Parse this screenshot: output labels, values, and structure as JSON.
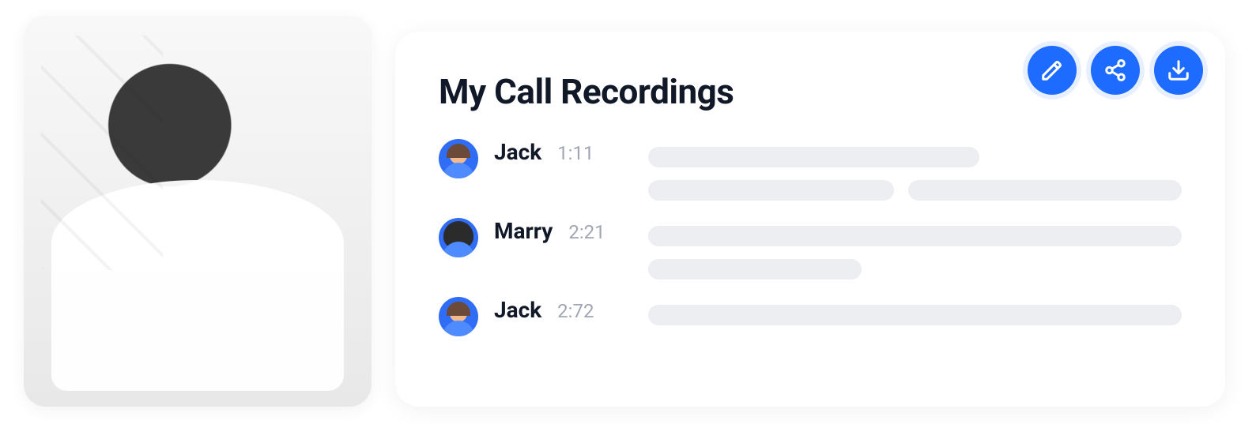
{
  "panel": {
    "title": "My Call Recordings"
  },
  "actions": {
    "edit": "edit",
    "share": "share",
    "download": "download"
  },
  "recordings": [
    {
      "name": "Jack",
      "time": "1:11",
      "avatar": "male"
    },
    {
      "name": "Marry",
      "time": "2:21",
      "avatar": "female"
    },
    {
      "name": "Jack",
      "time": "2:72",
      "avatar": "male"
    }
  ]
}
